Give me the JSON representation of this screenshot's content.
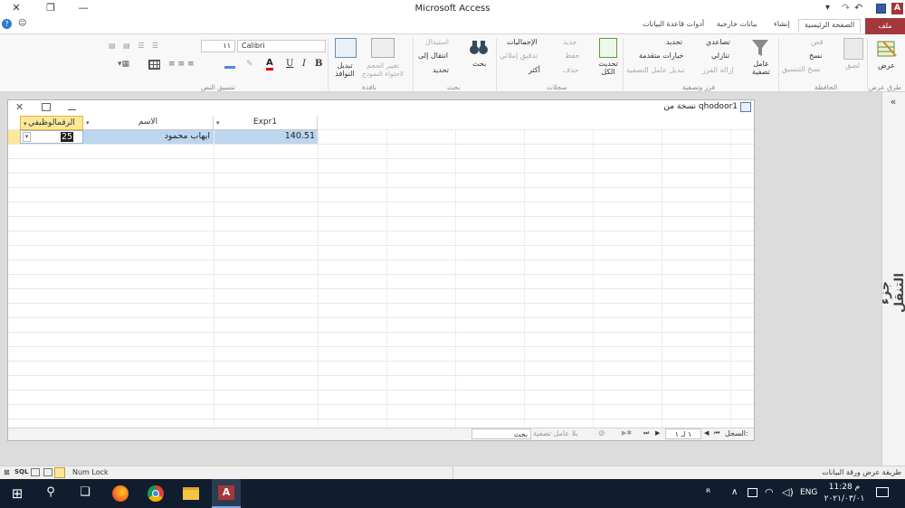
{
  "titlebar": {
    "title": "Microsoft Access",
    "minimize_icon": "—",
    "restore_icon": "❐",
    "close_icon": "✕",
    "help_icon": "?",
    "user_mark": "☺"
  },
  "qat": {
    "more": "▾",
    "undo": "↶",
    "redo": "↷"
  },
  "tabs": {
    "file": "ملف",
    "home": "الصفحة الرئيسية",
    "create": "إنشاء",
    "external": "بيانات خارجية",
    "dbtools": "أدوات قاعدة البيانات"
  },
  "ribbon": {
    "views": {
      "view": "عرض",
      "group": "طرق عرض"
    },
    "clipboard": {
      "cut": "قص",
      "copy": "نسخ",
      "painter": "نسخ التنسيق",
      "paste": "لصق",
      "group": "الحافظة"
    },
    "sort": {
      "filter": "عامل تصفية",
      "asc": "تصاعدي",
      "desc": "تنازلي",
      "remove_sort": "إزالة الفرز",
      "selection": "تحديد",
      "advanced": "خيارات متقدمة",
      "toggle": "تبديل عامل التصفية",
      "group": "فرز وتصفية"
    },
    "records": {
      "refresh": "تحديث الكل",
      "new": "جديد",
      "save": "حفظ",
      "delete": "حذف",
      "totals": "الإجماليات",
      "spelling": "تدقيق إملائي",
      "more": "أكثر",
      "group": "سجلات"
    },
    "find": {
      "find": "بحث",
      "replace": "استبدال",
      "goto": "انتقال إلى",
      "select": "تحديد",
      "group": "بحث"
    },
    "window": {
      "size": "تغيير الحجم لاحتواء النموذج",
      "switch": "تبديل النوافذ",
      "group": "نافذة"
    },
    "text": {
      "font": "Calibri",
      "size": "١١",
      "bold": "B",
      "italic": "I",
      "underline": "U",
      "group": "تنسيق النص"
    }
  },
  "document": {
    "tab_title": "نسخة من  qhodoor1",
    "close_icon": "✕",
    "columns": [
      {
        "name": "Expr1"
      },
      {
        "name": "الاسم"
      },
      {
        "name": "الرقمالوظيفي"
      }
    ],
    "row": {
      "expr1": "140.51",
      "name": "ايهاب محمود",
      "id": "25"
    }
  },
  "navbar": {
    "record_label": "السجل:",
    "record_pos": "١ لـ ١",
    "filter_status": "بلا عامل تصفية",
    "search_label": "بحث",
    "first": "⏮",
    "prev": "◀",
    "next": "▶",
    "last": "⏭",
    "new": "▶✱"
  },
  "nav_pane": {
    "label": "جزء التنقل",
    "toggle": "«"
  },
  "status": {
    "left": "طريقة عرض ورقة البيانات",
    "numlock": "Num Lock",
    "sql": "SQL"
  },
  "taskbar": {
    "lang": "ENG",
    "time": "11:28 م",
    "date": "٢٠٢١/٠٣/٠١",
    "start_icon": "⊞",
    "search_icon": "⚲",
    "taskview_icon": "❑"
  }
}
